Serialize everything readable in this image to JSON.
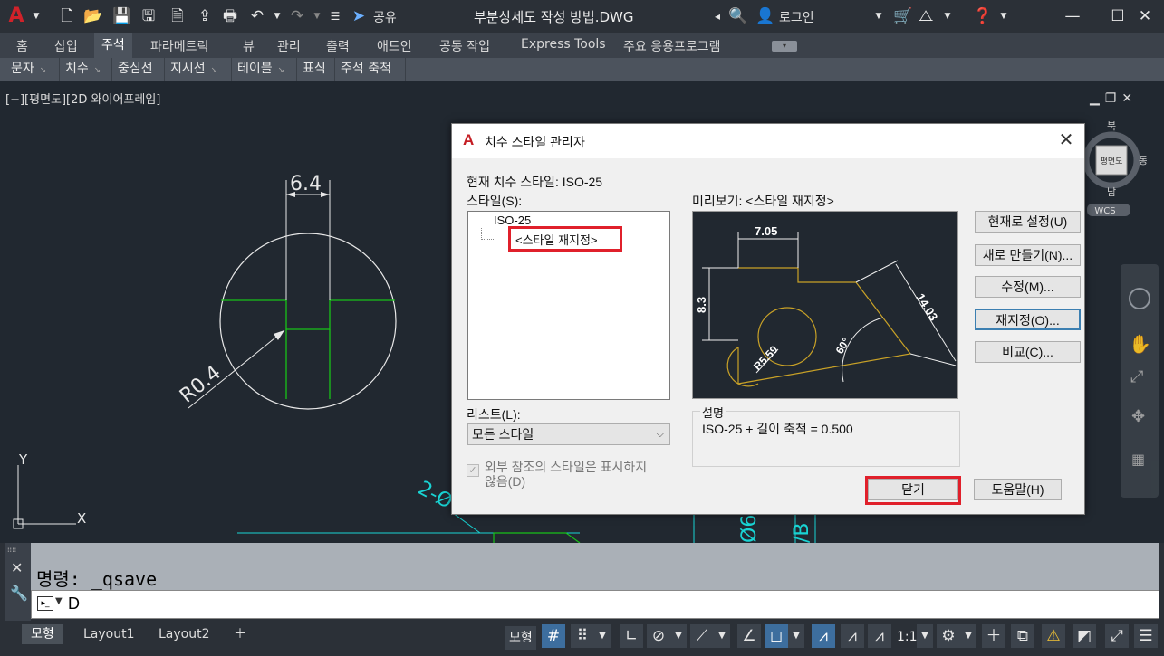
{
  "titlebar": {
    "document_title": "부분상세도 작성 방법.DWG",
    "share_label": "공유",
    "login_label": "로그인"
  },
  "ribbon": {
    "tabs": [
      "홈",
      "삽입",
      "주석",
      "파라메트릭",
      "뷰",
      "관리",
      "출력",
      "애드인",
      "공동 작업",
      "Express Tools",
      "주요 응용프로그램"
    ],
    "active_tab": "주석",
    "panels": [
      "문자",
      "치수",
      "중심선",
      "지시선",
      "테이블",
      "표식",
      "주석 축척"
    ]
  },
  "viewport": {
    "label": "[−][평면도][2D 와이어프레임]",
    "viewcube": {
      "face": "평면도",
      "north": "북",
      "east": "동",
      "south": "남",
      "wcs": "WCS"
    },
    "drawing": {
      "dim_top": "6.4",
      "dim_radius": "R0.4",
      "ucs_y": "Y",
      "ucs_x": "X",
      "partial_text_1": "2-Ø",
      "partial_text_2": "Ø6",
      "partial_text_3": "/B"
    }
  },
  "dialog": {
    "title": "치수 스타일 관리자",
    "current_style_label": "현재 치수 스타일: ISO-25",
    "styles_label": "스타일(S):",
    "styles": [
      "ISO-25",
      "<스타일 재지정>"
    ],
    "preview_label": "미리보기: <스타일 재지정>",
    "preview_dims": {
      "d1": "7.05",
      "d2": "8.3",
      "d3": "14.03",
      "d4": "R5.59",
      "d5": "60°"
    },
    "list_label": "리스트(L):",
    "list_value": "모든 스타일",
    "xref_checkbox_label_1": "외부 참조의 스타일은 표시하지",
    "xref_checkbox_label_2": "않음(D)",
    "description_label": "설명",
    "description_text": "ISO-25 + 길이 축척 = 0.500",
    "buttons": {
      "set_current": "현재로 설정(U)",
      "new": "새로 만들기(N)...",
      "modify": "수정(M)...",
      "override": "재지정(O)...",
      "compare": "비교(C)...",
      "close": "닫기",
      "help": "도움말(H)"
    }
  },
  "command": {
    "history": "명령:  _qsave",
    "input_value": "D"
  },
  "statusbar": {
    "tabs": [
      "모형",
      "Layout1",
      "Layout2"
    ],
    "model_label": "모형",
    "scale": "1:1"
  },
  "colors": {
    "highlight_red": "#e0202b",
    "acad_red": "#c41d23",
    "focus_blue": "#3c7fb1",
    "geometry_green": "#18c218",
    "dim_cyan": "#19d3d3"
  }
}
